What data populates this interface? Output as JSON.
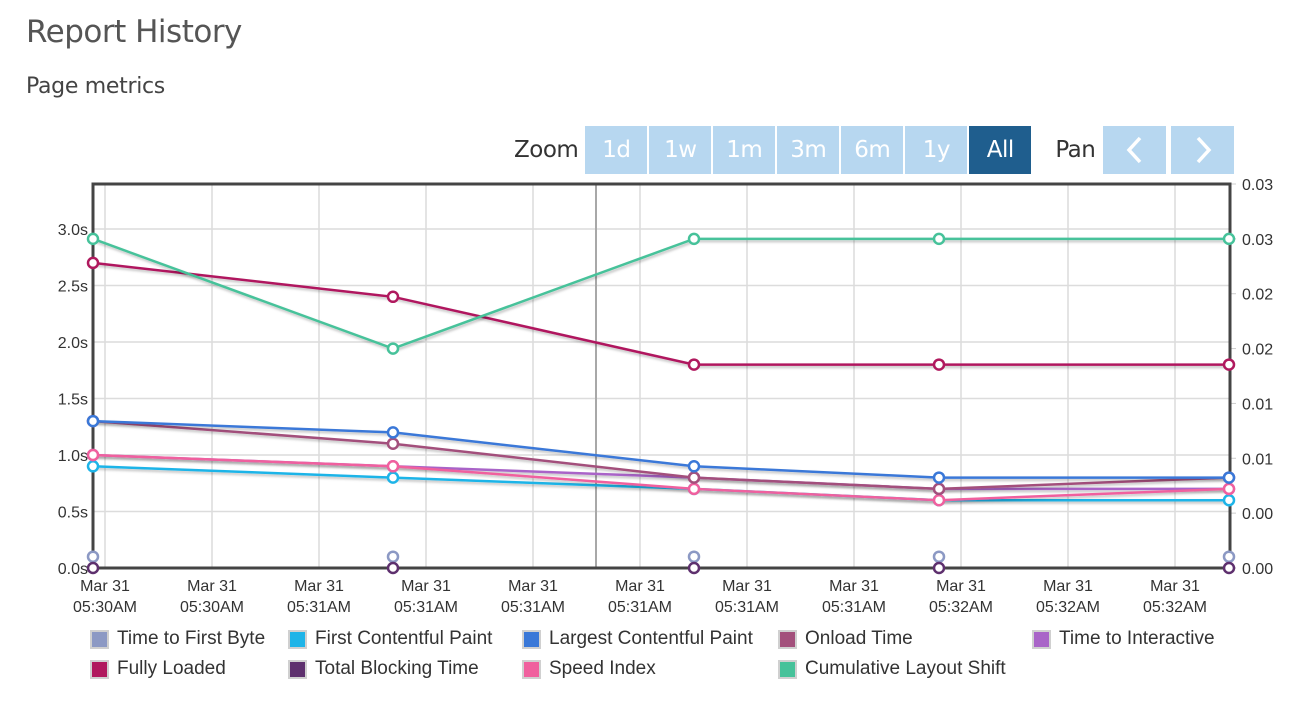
{
  "page": {
    "title": "Report History",
    "subtitle": "Page metrics"
  },
  "range_selector": {
    "zoom_label": "Zoom",
    "buttons": [
      {
        "label": "1d",
        "active": false
      },
      {
        "label": "1w",
        "active": false
      },
      {
        "label": "1m",
        "active": false
      },
      {
        "label": "3m",
        "active": false
      },
      {
        "label": "6m",
        "active": false
      },
      {
        "label": "1y",
        "active": false
      },
      {
        "label": "All",
        "active": true
      }
    ],
    "pan_label": "Pan",
    "pan_buttons": [
      {
        "icon": "chevron-left-icon"
      },
      {
        "icon": "chevron-right-icon"
      }
    ]
  },
  "chart_data": {
    "type": "line",
    "title": "Page metrics",
    "x_points": 5,
    "x_tick_labels": [
      [
        "Mar 31",
        "05:30AM"
      ],
      [
        "Mar 31",
        "05:30AM"
      ],
      [
        "Mar 31",
        "05:31AM"
      ],
      [
        "Mar 31",
        "05:31AM"
      ],
      [
        "Mar 31",
        "05:31AM"
      ],
      [
        "Mar 31",
        "05:31AM"
      ],
      [
        "Mar 31",
        "05:31AM"
      ],
      [
        "Mar 31",
        "05:31AM"
      ],
      [
        "Mar 31",
        "05:32AM"
      ],
      [
        "Mar 31",
        "05:32AM"
      ],
      [
        "Mar 31",
        "05:32AM"
      ]
    ],
    "y_left": {
      "label": "",
      "unit": "s",
      "range": [
        0,
        3.4
      ],
      "ticks": [
        "0.0s",
        "0.5s",
        "1.0s",
        "1.5s",
        "2.0s",
        "2.5s",
        "3.0s"
      ],
      "tick_values": [
        0,
        0.5,
        1.0,
        1.5,
        2.0,
        2.5,
        3.0
      ]
    },
    "y_right": {
      "label": "",
      "range": [
        0,
        0.035
      ],
      "ticks": [
        "0.00",
        "0.00",
        "0.01",
        "0.01",
        "0.02",
        "0.02",
        "0.03",
        "0.03"
      ],
      "tick_values": [
        0,
        0.005,
        0.01,
        0.015,
        0.02,
        0.025,
        0.03,
        0.035
      ]
    },
    "grid": true,
    "legend_position": "bottom",
    "series": [
      {
        "name": "Time to First Byte",
        "color": "#8c99c4",
        "axis": "left",
        "values": [
          0.1,
          0.1,
          0.1,
          0.1,
          0.1
        ]
      },
      {
        "name": "First Contentful Paint",
        "color": "#1eb4e8",
        "axis": "left",
        "values": [
          0.9,
          0.8,
          0.7,
          0.6,
          0.6
        ]
      },
      {
        "name": "Largest Contentful Paint",
        "color": "#3a78d8",
        "axis": "left",
        "values": [
          1.3,
          1.2,
          0.9,
          0.8,
          0.8
        ]
      },
      {
        "name": "Onload Time",
        "color": "#a3507c",
        "axis": "left",
        "values": [
          1.3,
          1.1,
          0.8,
          0.7,
          0.8
        ]
      },
      {
        "name": "Time to Interactive",
        "color": "#a964c8",
        "axis": "left",
        "values": [
          1.0,
          0.9,
          0.8,
          0.7,
          0.7
        ]
      },
      {
        "name": "Fully Loaded",
        "color": "#b0195e",
        "axis": "left",
        "values": [
          2.7,
          2.4,
          1.8,
          1.8,
          1.8
        ]
      },
      {
        "name": "Total Blocking Time",
        "color": "#5e306e",
        "axis": "left",
        "values": [
          0,
          0,
          0,
          0,
          0
        ]
      },
      {
        "name": "Speed Index",
        "color": "#f0609e",
        "axis": "left",
        "values": [
          1.0,
          0.9,
          0.7,
          0.6,
          0.7
        ]
      },
      {
        "name": "Cumulative Layout Shift",
        "color": "#46c29a",
        "axis": "right",
        "values": [
          0.03,
          0.02,
          0.03,
          0.03,
          0.03
        ]
      }
    ],
    "draw_order": [
      0,
      6,
      1,
      4,
      7,
      3,
      2,
      5,
      8
    ]
  }
}
